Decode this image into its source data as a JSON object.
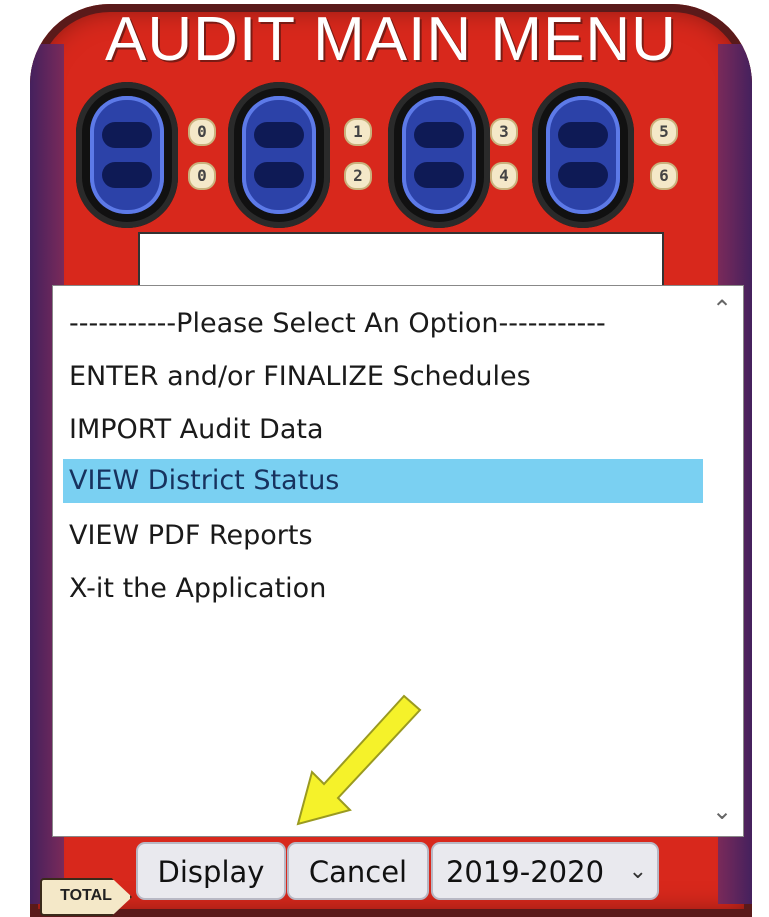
{
  "window": {
    "title": "AUDIT MAIN MENU"
  },
  "reel_numbers": [
    "0",
    "0",
    "1",
    "2",
    "3",
    "4",
    "5",
    "6"
  ],
  "listbox": {
    "options": [
      "-----------Please Select An Option-----------",
      "ENTER and/or FINALIZE Schedules",
      "IMPORT Audit Data",
      "VIEW District Status",
      "VIEW PDF Reports",
      "X-it the Application"
    ],
    "selected": "VIEW District Status"
  },
  "buttons": {
    "display": "Display",
    "cancel": "Cancel"
  },
  "year_select": {
    "value": "2019-2020"
  },
  "total_label": "TOTAL",
  "icons": {
    "scroll_up": "chevron-up-icon",
    "scroll_down": "chevron-down-icon",
    "arrow": "pointer-arrow-icon"
  },
  "colors": {
    "selection": "#7ad0f2",
    "machine": "#d8281c",
    "arrow": "#f5f22a"
  }
}
